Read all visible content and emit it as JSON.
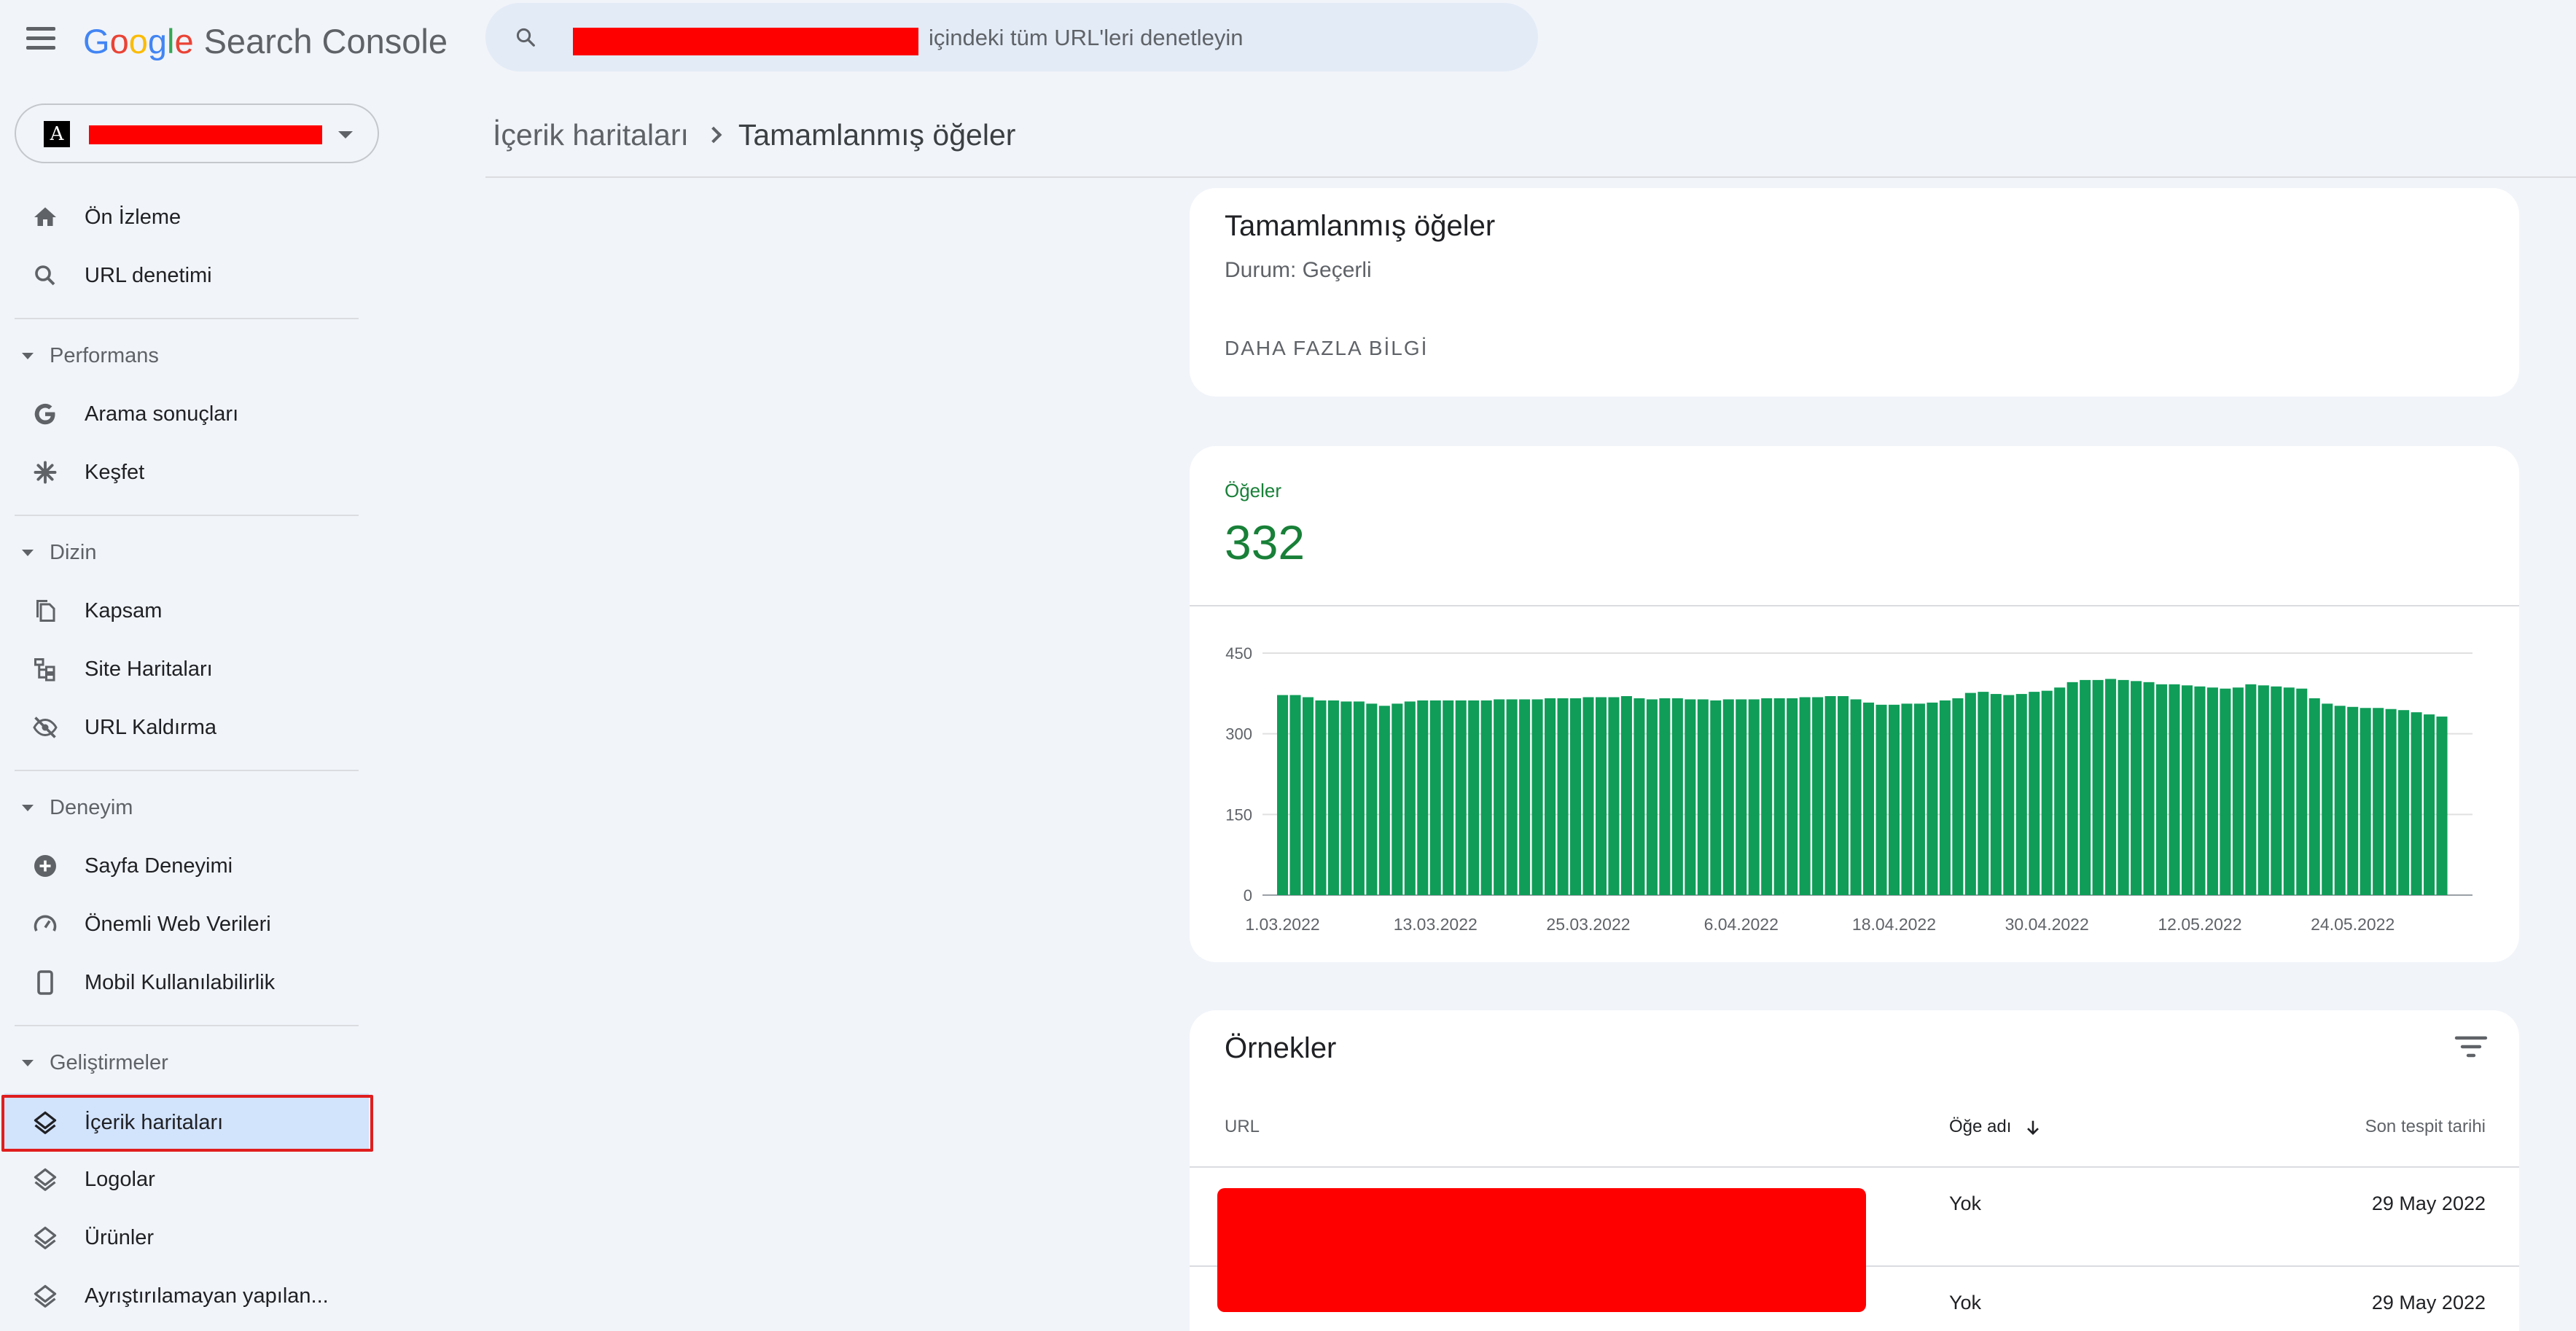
{
  "app": {
    "logo_letters": [
      "G",
      "o",
      "o",
      "g",
      "l",
      "e"
    ],
    "product": "Search Console",
    "logo_colors": [
      "#4285f4",
      "#ea4335",
      "#fbbc05",
      "#4285f4",
      "#34a853",
      "#ea4335"
    ]
  },
  "search": {
    "placeholder": "içindeki tüm URL'leri denetleyin",
    "icon": "search-icon"
  },
  "property": {
    "favicon_letter": "A"
  },
  "sidebar": {
    "items": [
      {
        "label": "Ön İzleme",
        "icon": "home-icon"
      },
      {
        "label": "URL denetimi",
        "icon": "search-icon"
      }
    ],
    "sections": [
      {
        "label": "Performans",
        "items": [
          {
            "label": "Arama sonuçları",
            "icon": "google-g-icon"
          },
          {
            "label": "Keşfet",
            "icon": "asterisk-icon"
          }
        ]
      },
      {
        "label": "Dizin",
        "items": [
          {
            "label": "Kapsam",
            "icon": "pages-icon"
          },
          {
            "label": "Site Haritaları",
            "icon": "sitemap-icon"
          },
          {
            "label": "URL Kaldırma",
            "icon": "eye-off-icon"
          }
        ]
      },
      {
        "label": "Deneyim",
        "items": [
          {
            "label": "Sayfa Deneyimi",
            "icon": "plus-circle-icon"
          },
          {
            "label": "Önemli Web Verileri",
            "icon": "speed-gauge-icon"
          },
          {
            "label": "Mobil Kullanılabilirlik",
            "icon": "phone-icon"
          }
        ]
      },
      {
        "label": "Geliştirmeler",
        "items": [
          {
            "label": "İçerik haritaları",
            "icon": "layers-icon",
            "active": true
          },
          {
            "label": "Logolar",
            "icon": "layers-icon"
          },
          {
            "label": "Ürünler",
            "icon": "layers-icon"
          },
          {
            "label": "Ayrıştırılamayan yapılan...",
            "icon": "layers-icon"
          }
        ]
      }
    ]
  },
  "breadcrumb": {
    "parent": "İçerik haritaları",
    "current": "Tamamlanmış öğeler"
  },
  "summary_card": {
    "title": "Tamamlanmış öğeler",
    "status": "Durum: Geçerli",
    "more_link": "DAHA FAZLA BİLGİ"
  },
  "metric": {
    "label": "Öğeler",
    "value": "332",
    "color": "#188038"
  },
  "chart_data": {
    "type": "bar",
    "color": "#0f9d58",
    "ylim": [
      0,
      450
    ],
    "yticks": [
      0,
      150,
      300,
      450
    ],
    "xtick_labels": [
      "1.03.2022",
      "13.03.2022",
      "25.03.2022",
      "6.04.2022",
      "18.04.2022",
      "30.04.2022",
      "12.05.2022",
      "24.05.2022"
    ],
    "xtick_indices": [
      0,
      12,
      24,
      36,
      48,
      60,
      72,
      84
    ],
    "grid": true,
    "values": [
      372,
      372,
      368,
      362,
      362,
      360,
      360,
      356,
      352,
      356,
      360,
      362,
      362,
      362,
      362,
      362,
      362,
      364,
      364,
      364,
      364,
      366,
      366,
      366,
      368,
      368,
      368,
      370,
      366,
      364,
      366,
      366,
      364,
      364,
      362,
      364,
      364,
      364,
      366,
      366,
      366,
      368,
      368,
      370,
      370,
      364,
      358,
      354,
      354,
      356,
      356,
      358,
      362,
      366,
      376,
      378,
      374,
      372,
      374,
      378,
      380,
      386,
      396,
      400,
      400,
      402,
      400,
      398,
      396,
      392,
      392,
      390,
      388,
      386,
      384,
      386,
      392,
      390,
      388,
      386,
      384,
      366,
      356,
      352,
      350,
      348,
      348,
      346,
      344,
      340,
      336,
      332
    ]
  },
  "examples": {
    "title": "Örnekler",
    "columns": {
      "url": "URL",
      "name": "Öğe adı",
      "date": "Son tespit tarihi"
    },
    "rows": [
      {
        "name": "Yok",
        "date": "29 May 2022"
      },
      {
        "name": "Yok",
        "date": "29 May 2022"
      }
    ]
  }
}
